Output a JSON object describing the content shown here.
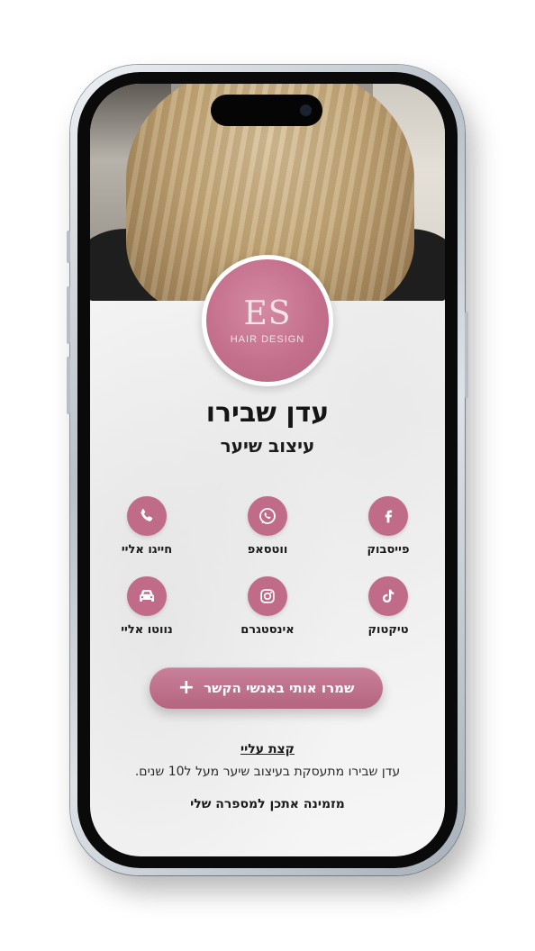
{
  "profile": {
    "logo_mark": "ES",
    "logo_sub": "HAIR DESIGN",
    "name": "עדן שבירו",
    "title": "עיצוב שיער"
  },
  "actions": {
    "facebook": "פייסבוק",
    "whatsapp": "ווטסאפ",
    "call": "חייגו אליי",
    "tiktok": "טיקטוק",
    "instagram": "אינסטגרם",
    "navigate": "נווטו אליי"
  },
  "save_contact": {
    "label": "שמרו אותי באנשי הקשר",
    "plus": "+"
  },
  "about": {
    "title": "קצת עליי",
    "text": "עדן שבירו מתעסקת בעיצוב שיער מעל ל10 שנים.",
    "invite": "מזמינה אתכן למספרה שלי"
  },
  "colors": {
    "accent": "#c06c89",
    "text": "#1a1a1a"
  },
  "icons": {
    "facebook": "facebook-icon",
    "whatsapp": "whatsapp-icon",
    "call": "phone-icon",
    "tiktok": "tiktok-icon",
    "instagram": "instagram-icon",
    "navigate": "car-icon"
  }
}
